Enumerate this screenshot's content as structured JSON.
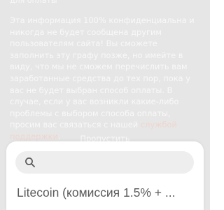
{
  "background": {
    "heading_tail": "для оплаты",
    "paragraph_before_link": "Эта информация 100% конфиденциальна и никогда не будет сообщена другим пользователям сайта! Вы сможете заполнить эту графу позже, но имейте в виду, что мы не сможем перечислить вам заработанные средства до тех пор, пока у вас не будет выбран способ оплаты. В случае, если у вас возникли какие-либо проблемы с выбором способа оплаты, просим вас связаться с нашей",
    "support_link": "службой поддержки",
    "paragraph_end": ".",
    "skip_link": "Пропустить"
  },
  "sheet": {
    "search": {
      "placeholder": "",
      "value": "",
      "icon": "search-icon"
    },
    "payment_method": "Litecoin (комиссия 1.5% + ..."
  }
}
